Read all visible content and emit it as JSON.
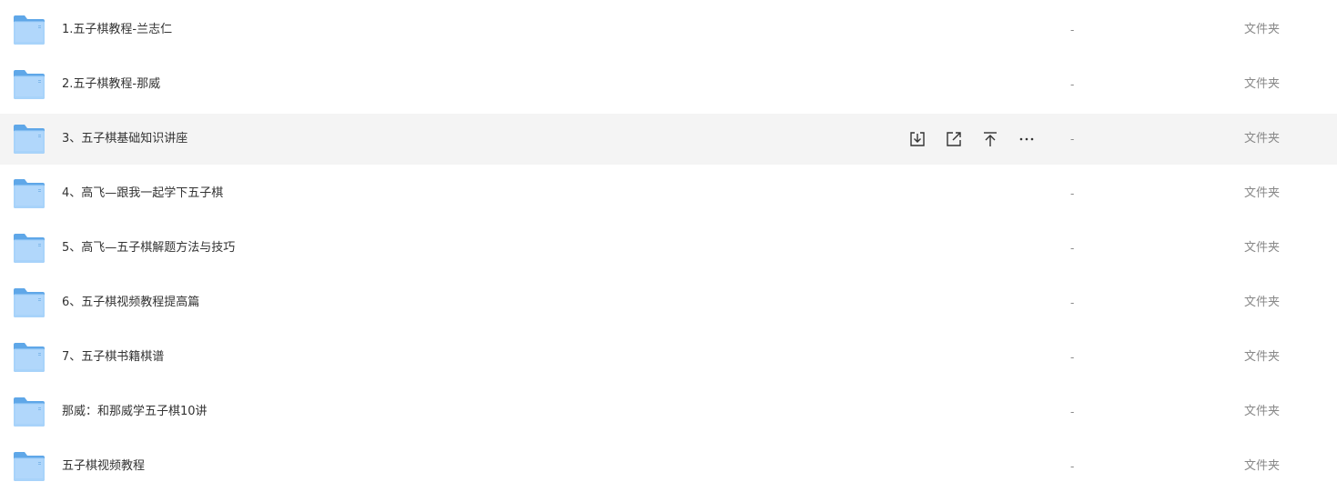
{
  "file_list": {
    "rows": [
      {
        "name": "1.五子棋教程-兰志仁",
        "size": "-",
        "type": "文件夹",
        "icon": "folder-icon"
      },
      {
        "name": "2.五子棋教程-那威",
        "size": "-",
        "type": "文件夹",
        "icon": "folder-icon"
      },
      {
        "name": "3、五子棋基础知识讲座",
        "size": "-",
        "type": "文件夹",
        "icon": "folder-icon",
        "hovered": true
      },
      {
        "name": "4、高飞—跟我一起学下五子棋",
        "size": "-",
        "type": "文件夹",
        "icon": "folder-icon"
      },
      {
        "name": "5、高飞—五子棋解题方法与技巧",
        "size": "-",
        "type": "文件夹",
        "icon": "folder-icon"
      },
      {
        "name": "6、五子棋视频教程提高篇",
        "size": "-",
        "type": "文件夹",
        "icon": "folder-icon"
      },
      {
        "name": "7、五子棋书籍棋谱",
        "size": "-",
        "type": "文件夹",
        "icon": "folder-icon"
      },
      {
        "name": "那威：和那威学五子棋10讲",
        "size": "-",
        "type": "文件夹",
        "icon": "folder-icon"
      },
      {
        "name": "五子棋视频教程",
        "size": "-",
        "type": "文件夹",
        "icon": "folder-icon"
      }
    ],
    "row_actions": [
      {
        "icon": "download-icon"
      },
      {
        "icon": "share-icon"
      },
      {
        "icon": "move-to-top-icon"
      },
      {
        "icon": "more-icon"
      }
    ]
  },
  "colors": {
    "row_hover_bg": "#f4f4f4",
    "name_text": "#333333",
    "meta_text": "#888888",
    "folder_blue": "#7bbcf2"
  }
}
